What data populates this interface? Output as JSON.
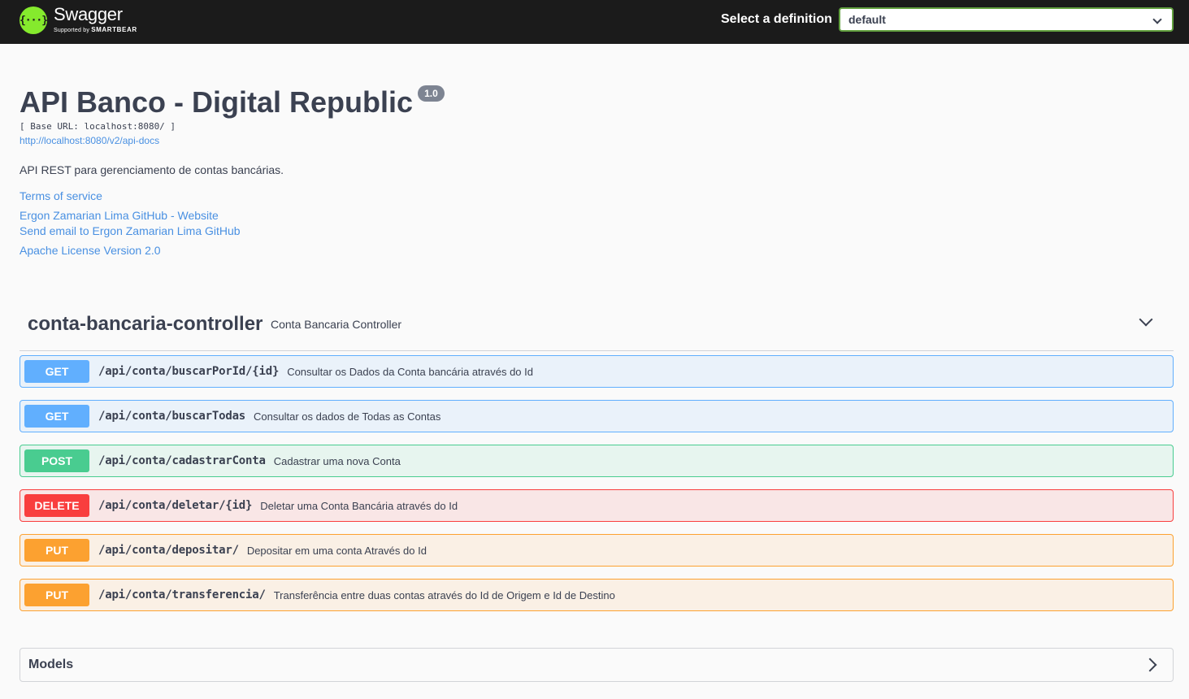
{
  "topbar": {
    "logo_icon": "{···}",
    "logo_title": "Swagger",
    "logo_sub_prefix": "Supported by",
    "logo_sub_brand": "SMARTBEAR",
    "select_label": "Select a definition",
    "select_value": "default",
    "accent_color": "#85ea2d"
  },
  "info": {
    "title": "API Banco - Digital Republic",
    "version": "1.0",
    "base_url": "[ Base URL: localhost:8080/ ]",
    "docs_url": "http://localhost:8080/v2/api-docs",
    "description": "API REST para gerenciamento de contas bancárias.",
    "links": {
      "terms": "Terms of service",
      "website": "Ergon Zamarian Lima GitHub - Website",
      "email": "Send email to Ergon Zamarian Lima GitHub",
      "license": "Apache License Version 2.0"
    }
  },
  "tag": {
    "name": "conta-bancaria-controller",
    "description": "Conta Bancaria Controller",
    "expand_icon": "chevron-down-icon"
  },
  "operations": [
    {
      "method": "GET",
      "path": "/api/conta/buscarPorId/{id}",
      "summary": "Consultar os Dados da Conta bancária através do Id",
      "color": "#61affe"
    },
    {
      "method": "GET",
      "path": "/api/conta/buscarTodas",
      "summary": "Consultar os dados de Todas as Contas",
      "color": "#61affe"
    },
    {
      "method": "POST",
      "path": "/api/conta/cadastrarConta",
      "summary": "Cadastrar uma nova Conta",
      "color": "#49cc90"
    },
    {
      "method": "DELETE",
      "path": "/api/conta/deletar/{id}",
      "summary": "Deletar uma Conta Bancária através do Id",
      "color": "#f93e3e"
    },
    {
      "method": "PUT",
      "path": "/api/conta/depositar/",
      "summary": "Depositar em uma conta Através do Id",
      "color": "#fca130"
    },
    {
      "method": "PUT",
      "path": "/api/conta/transferencia/",
      "summary": "Transferência entre duas contas através do Id de Origem e Id de Destino",
      "color": "#fca130"
    }
  ],
  "models": {
    "title": "Models",
    "expand_icon": "chevron-right-icon"
  }
}
